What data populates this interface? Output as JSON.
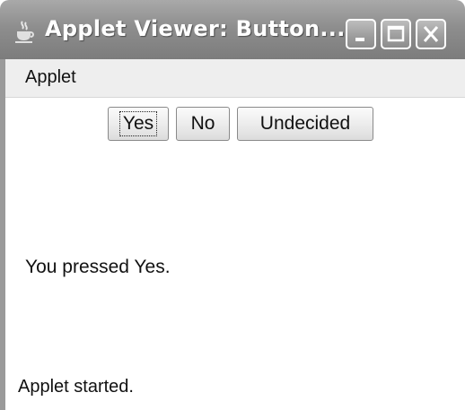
{
  "window": {
    "title": "Applet Viewer: Button...",
    "icon": "java-cup-icon",
    "controls": [
      "minimize-icon",
      "maximize-icon",
      "close-icon"
    ]
  },
  "menubar": {
    "items": [
      {
        "label": "Applet"
      }
    ]
  },
  "content": {
    "buttons": [
      {
        "label": "Yes",
        "focused": true
      },
      {
        "label": "No",
        "focused": false
      },
      {
        "label": "Undecided",
        "focused": false
      }
    ],
    "message": "You pressed Yes."
  },
  "status": {
    "text": "Applet started."
  }
}
